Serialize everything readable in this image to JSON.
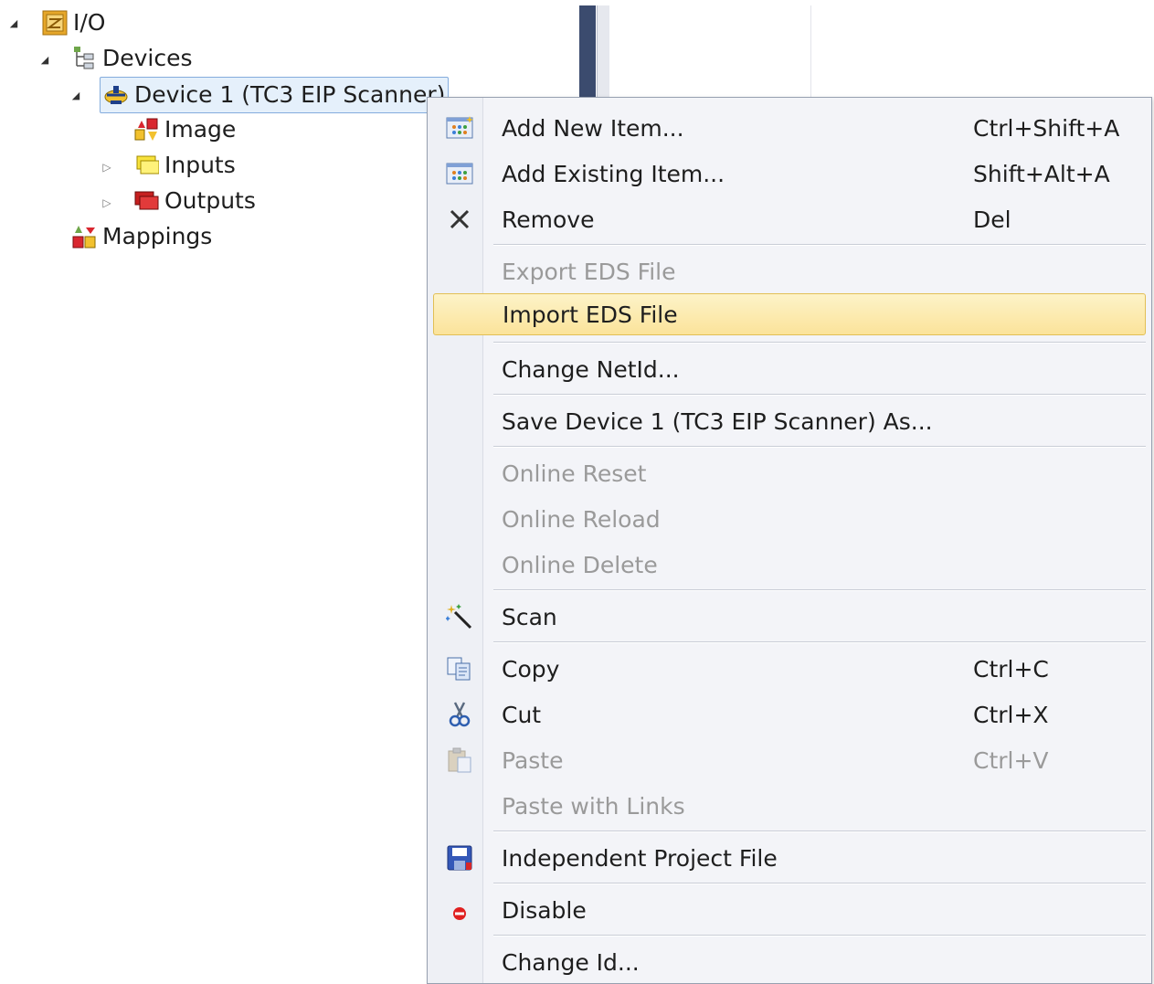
{
  "tree": {
    "io": "I/O",
    "devices": "Devices",
    "device1": "Device 1 (TC3 EIP Scanner)",
    "image": "Image",
    "inputs": "Inputs",
    "outputs": "Outputs",
    "mappings": "Mappings"
  },
  "menu": {
    "add_new": {
      "label": "Add New Item...",
      "shortcut": "Ctrl+Shift+A"
    },
    "add_existing": {
      "label": "Add Existing Item...",
      "shortcut": "Shift+Alt+A"
    },
    "remove": {
      "label": "Remove",
      "shortcut": "Del"
    },
    "export_eds": {
      "label": "Export EDS File"
    },
    "import_eds": {
      "label": "Import EDS File"
    },
    "change_netid": {
      "label": "Change NetId..."
    },
    "save_as": {
      "label": "Save Device 1 (TC3 EIP Scanner) As..."
    },
    "online_reset": {
      "label": "Online Reset"
    },
    "online_reload": {
      "label": "Online Reload"
    },
    "online_delete": {
      "label": "Online Delete"
    },
    "scan": {
      "label": "Scan"
    },
    "copy": {
      "label": "Copy",
      "shortcut": "Ctrl+C"
    },
    "cut": {
      "label": "Cut",
      "shortcut": "Ctrl+X"
    },
    "paste": {
      "label": "Paste",
      "shortcut": "Ctrl+V"
    },
    "paste_links": {
      "label": "Paste with Links"
    },
    "independent": {
      "label": "Independent Project File"
    },
    "disable": {
      "label": "Disable"
    },
    "change_id": {
      "label": "Change Id..."
    }
  },
  "colors": {
    "highlight": "#fbe39a",
    "selection": "#e5f0fb",
    "disabled_text": "#9a9a9a"
  }
}
